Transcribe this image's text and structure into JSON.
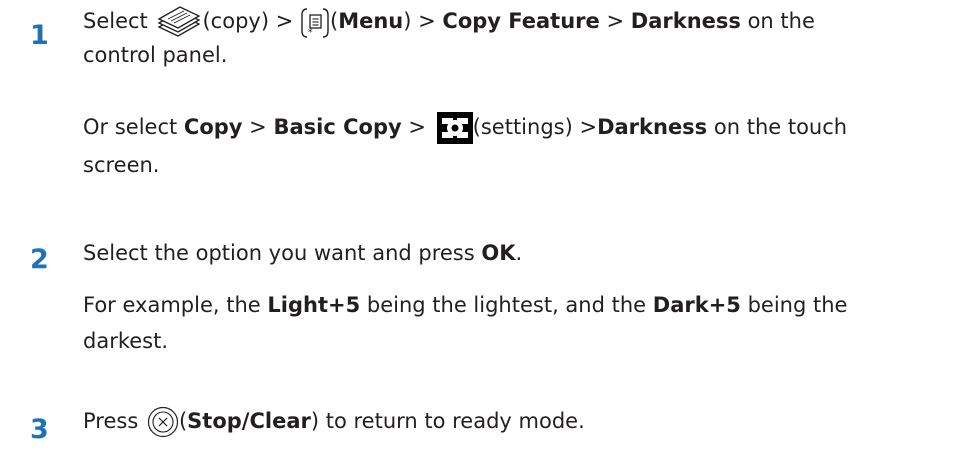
{
  "step1": {
    "number": "1",
    "select_word": "Select",
    "copy_paren": "(copy) >",
    "menu_label": "Menu",
    "gt1": ">",
    "copy_feature": "Copy Feature",
    "gt2": ">",
    "darkness": "Darkness",
    "on_the": "on the",
    "control_panel": "control panel.",
    "or_select": "Or select",
    "copy": "Copy",
    "gt3": ">",
    "basic_copy": "Basic Copy",
    "gt4": ">",
    "settings_paren": "(settings) >",
    "darkness2": "Darkness",
    "on_touch": "on the touch",
    "screen": "screen."
  },
  "step2": {
    "number": "2",
    "select_text": "Select the option you want and press",
    "ok": "OK",
    "period": ".",
    "example_pre": "For example, the",
    "light": "Light+5",
    "example_mid": "being the lightest, and the",
    "dark": "Dark+5",
    "example_post": "being the",
    "darkest": "darkest."
  },
  "step3": {
    "number": "3",
    "press": "Press",
    "stop_clear": "Stop/Clear",
    "rest": "to return to ready mode."
  },
  "icons": {
    "copy": "copy-icon",
    "menu": "menu-icon",
    "settings": "settings-icon",
    "stop": "stop-clear-icon"
  }
}
